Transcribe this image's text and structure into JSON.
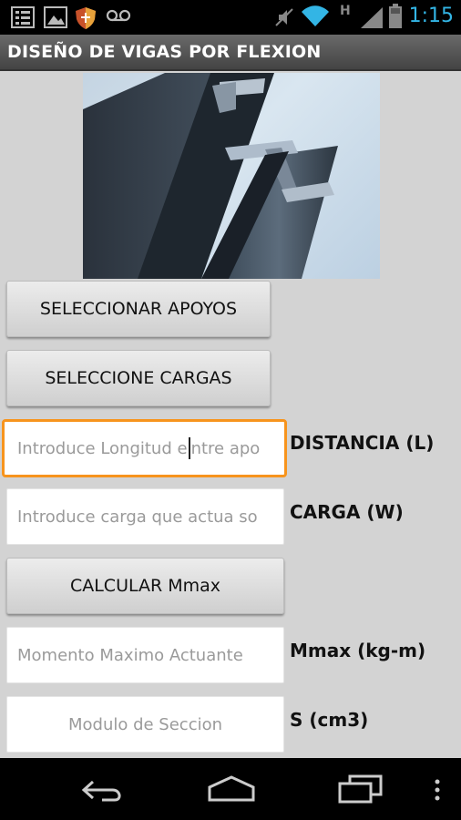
{
  "status_bar": {
    "time": "1:15",
    "left_icons": [
      "list-icon",
      "image-icon",
      "shield-icon",
      "voicemail-icon"
    ],
    "right_icons": [
      "mute-icon",
      "wifi-icon",
      "signal-icon",
      "battery-icon"
    ],
    "network_letter": "H",
    "accent": "#33b5e5"
  },
  "app": {
    "title": "DISEÑO DE VIGAS POR FLEXION"
  },
  "buttons": {
    "select_supports": "SELECCIONAR APOYOS",
    "select_loads": "SELECCIONE CARGAS",
    "calculate": "CALCULAR Mmax"
  },
  "fields": {
    "length": {
      "placeholder_before": "Introduce Longitud e",
      "placeholder_after": "ntre apo",
      "label": "DISTANCIA (L)"
    },
    "load": {
      "placeholder": "Introduce carga que actua so",
      "label": "CARGA (W)"
    },
    "moment": {
      "placeholder": "Momento Maximo Actuante",
      "label": "Mmax (kg-m)"
    },
    "section": {
      "placeholder": "Modulo de Seccion",
      "label": "S (cm3)"
    }
  },
  "colors": {
    "focus_border": "#f7941d",
    "background": "#d3d3d3"
  },
  "nav_bar": {
    "buttons": [
      "back-icon",
      "home-icon",
      "recent-apps-icon",
      "overflow-menu-icon"
    ]
  }
}
